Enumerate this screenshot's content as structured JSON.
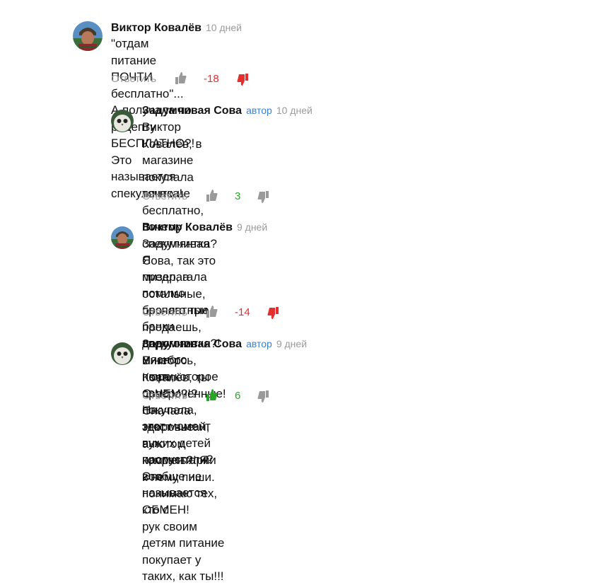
{
  "labels": {
    "reply": "Ответить",
    "author_badge": "автор"
  },
  "colors": {
    "negative": "#e52e2e",
    "positive": "#2aa52a",
    "inactive_icon": "#9a9a9a",
    "badge": "#3b7fd6"
  },
  "comments": [
    {
      "author": "Виктор Ковалёв",
      "time": "10 дней",
      "text": "\"отдам питание ПОЧТИ бесплатно\"... А получала по рецепту\nБЕСПЛАТНО?! Это называется спекулянтка!",
      "score": "-18",
      "vote": "dislike"
    },
    {
      "author": "Задумчивая Сова",
      "badge": "автор",
      "time": "10 дней",
      "text": "Виктор Ковалёв, в магазине покупала точно не бесплатно, почему\nспекулянтка? Я предлагала помимо прочего три банки дорогого\nмясного пюре,которое сама покупала, этот момент вы пропустили?\nЭто называется ОБМЕН!",
      "score": "3",
      "vote": "none"
    },
    {
      "author": "Виктор Ковалёв",
      "time": "9 дней",
      "text": "Задумчивая Сова, так это мизер, а остальные, бесплатные,\nпродаешь, спекулянтка?! И небось, почти просроченные! На\nздоровье чужих детей насрать?! Я вообще не понимаю тех, кто с\nрук своим детям питание покупает у таких, как ты!!!",
      "score": "-14",
      "vote": "dislike"
    },
    {
      "author": "Задумчивая Сова",
      "badge": "автор",
      "time": "9 дней",
      "text": "Виктор Ковалёв, ты О ЧЕМ?!? Сначала текст читай, а потом\nкомментарии к нему пиши.",
      "score": "6",
      "vote": "like"
    }
  ]
}
